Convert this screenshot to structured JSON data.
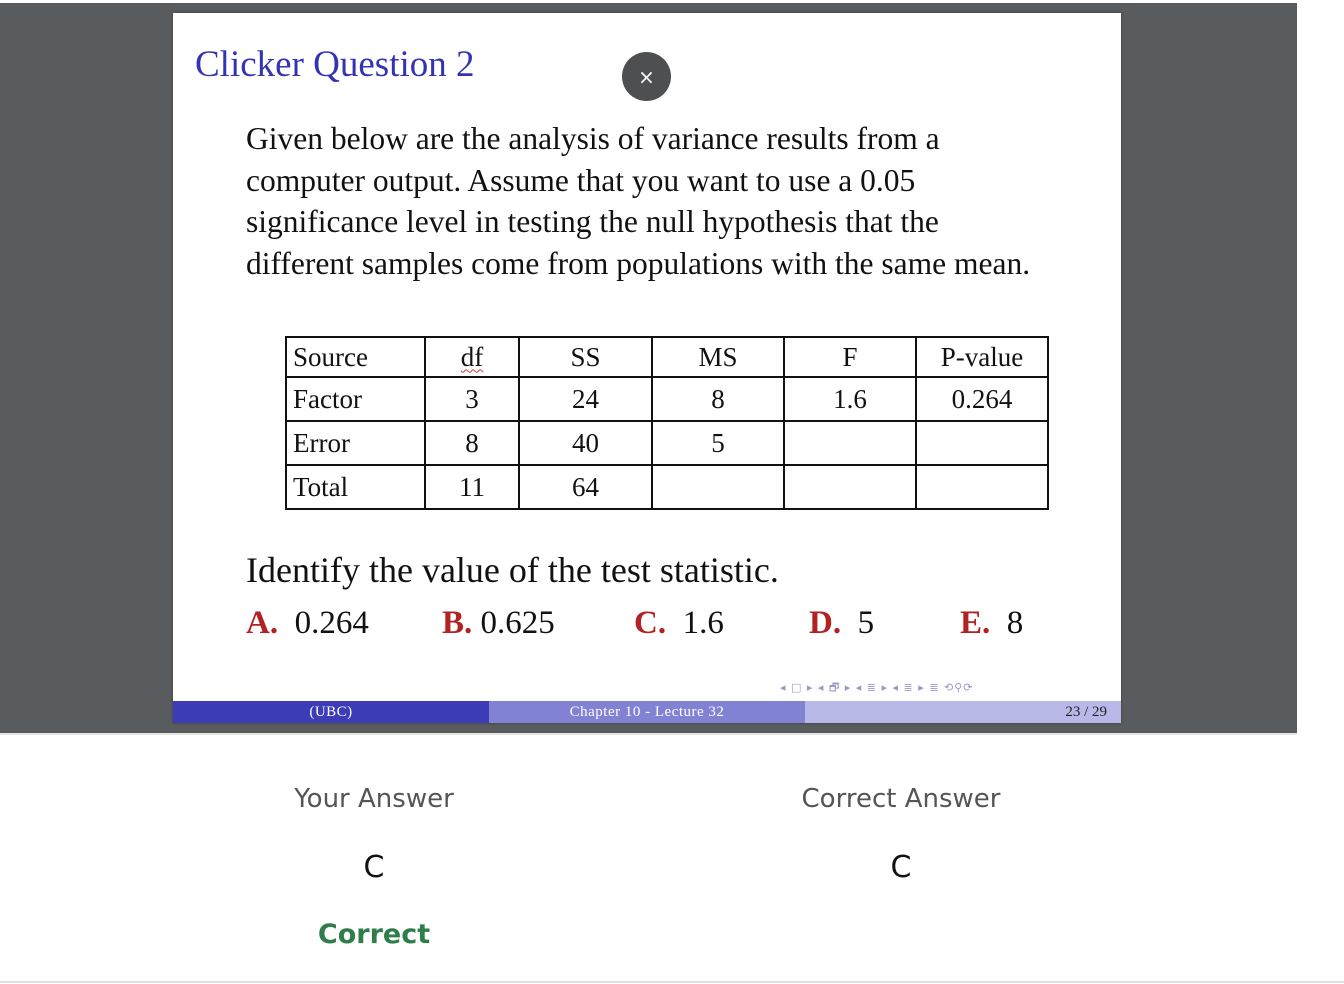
{
  "slide": {
    "title": "Clicker Question 2",
    "close_symbol": "×",
    "question": "Given below are the analysis of variance results from a computer output. Assume that you want to use a 0.05 significance level in testing the null hypothesis that the different samples come from populations with the same mean.",
    "table": {
      "headers": [
        "Source",
        "df",
        "SS",
        "MS",
        "F",
        "P-value"
      ],
      "rows": [
        [
          "Factor",
          "3",
          "24",
          "8",
          "1.6",
          "0.264"
        ],
        [
          "Error",
          "8",
          "40",
          "5",
          "",
          ""
        ],
        [
          "Total",
          "11",
          "64",
          "",
          "",
          ""
        ]
      ]
    },
    "prompt": "Identify the value of the test statistic.",
    "choices": [
      {
        "letter": "A.",
        "value": "0.264"
      },
      {
        "letter": "B.",
        "value": "0.625"
      },
      {
        "letter": "C.",
        "value": "1.6"
      },
      {
        "letter": "D.",
        "value": "5"
      },
      {
        "letter": "E.",
        "value": "8"
      }
    ],
    "nav_symbols": "◂ □ ▸  ◂ 🗗 ▸  ◂ ≣ ▸  ◂ ≣ ▸   ≣   ⟲⚲⟳",
    "footer": {
      "institution": "(UBC)",
      "chapter": "Chapter 10 - Lecture 32",
      "page": "23 / 29"
    }
  },
  "result": {
    "your_answer_label": "Your Answer",
    "your_answer": "C",
    "status": "Correct",
    "correct_answer_label": "Correct Answer",
    "correct_answer": "C"
  },
  "colors": {
    "title": "#3333b3",
    "choice_letter": "#b22222",
    "correct_status": "#2e7d4a",
    "stage_background": "#595c5e"
  }
}
